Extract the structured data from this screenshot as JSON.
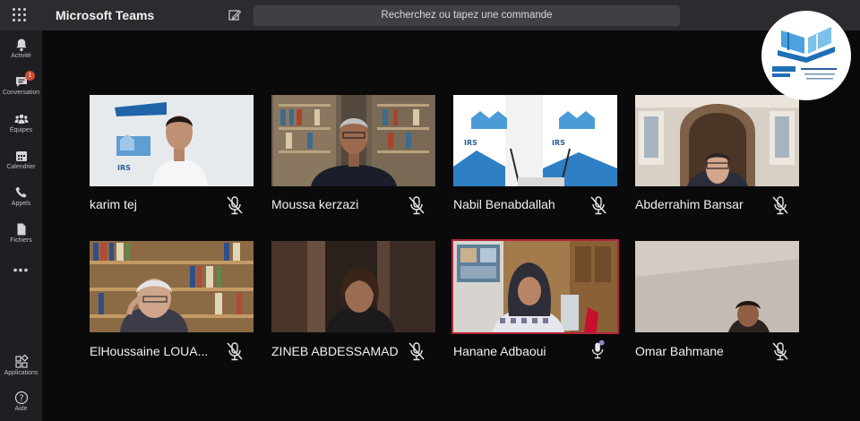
{
  "app": {
    "title": "Microsoft Teams"
  },
  "search": {
    "placeholder": "Recherchez ou tapez une commande"
  },
  "rail": {
    "items": [
      {
        "label": "Activité"
      },
      {
        "label": "Conversation",
        "badge": "1"
      },
      {
        "label": "Équipes"
      },
      {
        "label": "Calendrier"
      },
      {
        "label": "Appels"
      },
      {
        "label": "Fichiers"
      }
    ],
    "more": "•••",
    "bottom": [
      {
        "label": "Applications"
      },
      {
        "label": "Aide"
      }
    ]
  },
  "participants": [
    {
      "name": "karim tej",
      "mic": "muted"
    },
    {
      "name": "Moussa kerzazi",
      "mic": "muted"
    },
    {
      "name": "Nabil Benabdallah",
      "mic": "muted"
    },
    {
      "name": "Abderrahim Bansar",
      "mic": "muted"
    },
    {
      "name": "ElHoussaine LOUA...",
      "mic": "muted"
    },
    {
      "name": "ZINEB ABDESSAMAD",
      "mic": "muted"
    },
    {
      "name": "Hanane Adbaoui",
      "mic": "speaking"
    },
    {
      "name": "Omar Bahmane",
      "mic": "muted"
    }
  ],
  "colors": {
    "active_border": "#b3243a",
    "speaking": "#8b8cc7",
    "badge": "#cc4a31"
  }
}
